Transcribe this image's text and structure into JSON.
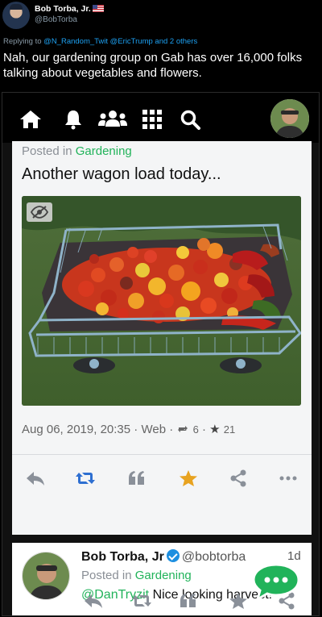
{
  "tweet": {
    "author_name": "Bob Torba, Jr.",
    "author_handle": "@BobTorba",
    "replying_prefix": "Replying to",
    "replying_to": "@N_Random_Twit @EricTrump and 2 others",
    "text": "Nah, our gardening group on Gab has over 16,000 folks talking about vegetables and flowers."
  },
  "gab_nav": {
    "icons": [
      "home-icon",
      "bell-icon",
      "groups-icon",
      "apps-grid-icon",
      "search-icon"
    ]
  },
  "post": {
    "posted_in_prefix": "Posted in",
    "group": "Gardening",
    "title": "Another wagon load today...",
    "date": "Aug 06, 2019, 20:35",
    "sep": "·",
    "visibility": "Web",
    "reposts": "6",
    "stars": "21"
  },
  "reply": {
    "name": "Bob Torba, Jr",
    "handle": "@bobtorba",
    "time": "1d",
    "posted_in_prefix": "Posted in",
    "group": "Gardening",
    "mention": "@DanTryzit",
    "text": "Nice looking harvest!"
  },
  "colors": {
    "gab_green": "#21b35a",
    "twitter_blue": "#1da1f2",
    "repost_blue": "#2e6fd1",
    "star_gold": "#e8a320",
    "verified_blue": "#1d8fe0"
  }
}
